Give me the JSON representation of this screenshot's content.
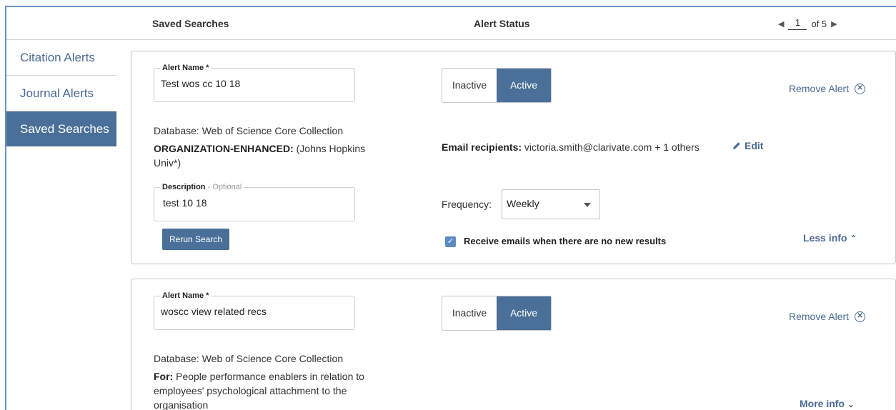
{
  "header": {
    "col_saved_searches": "Saved Searches",
    "col_alert_status": "Alert Status",
    "pager": {
      "current": "1",
      "of_label": "of 5"
    }
  },
  "sidebar": {
    "items": [
      {
        "label": "Citation Alerts"
      },
      {
        "label": "Journal Alerts"
      },
      {
        "label": "Saved Searches"
      }
    ]
  },
  "alerts": [
    {
      "name_label": "Alert Name *",
      "name_value": "Test wos cc 10 18",
      "inactive_label": "Inactive",
      "active_label": "Active",
      "remove_label": "Remove Alert",
      "database": "Database: Web of Science Core Collection",
      "query_key": "ORGANIZATION-ENHANCED:",
      "query_value": " (Johns Hopkins Univ*)",
      "email_key": "Email recipients:",
      "email_value": " victoria.smith@clarivate.com + 1 others",
      "edit_label": "Edit",
      "desc_label": "Description",
      "desc_optional": " - Optional",
      "desc_value": "test 10 18",
      "frequency_label": "Frequency:",
      "frequency_value": "Weekly",
      "rerun_label": "Rerun Search",
      "no_results_label": "Receive emails when there are no new results",
      "less_info_label": "Less info"
    },
    {
      "name_label": "Alert Name *",
      "name_value": "woscc  view related recs",
      "inactive_label": "Inactive",
      "active_label": "Active",
      "remove_label": "Remove Alert",
      "database": "Database: Web of Science Core Collection",
      "query_key": "For:",
      "query_value": " People performance enablers in relation to employees' psychological attachment to the organisation",
      "more_info_label": "More info"
    }
  ],
  "colors": {
    "accent": "#4a7099",
    "link": "#4a6a94",
    "frame": "#6b93c4"
  },
  "icons": [
    "caret-left-icon",
    "caret-right-icon",
    "close-circle-icon",
    "pencil-icon",
    "checkmark-icon",
    "chevron-up-icon",
    "chevron-down-icon",
    "dropdown-caret-icon"
  ]
}
